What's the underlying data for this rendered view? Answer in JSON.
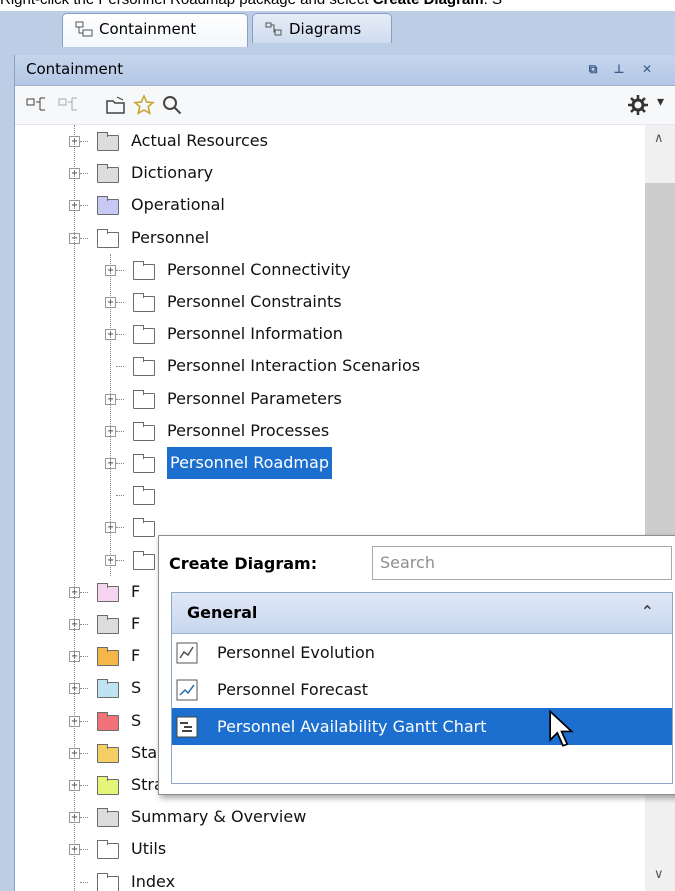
{
  "caption": {
    "pre": "Right-click the Personnel Roadmap package and select ",
    "bold": "Create Diagram",
    "post": ". S"
  },
  "tabs": [
    {
      "label": "Containment",
      "active": true,
      "icon": "containment-icon"
    },
    {
      "label": "Diagrams",
      "active": false,
      "icon": "diagrams-icon"
    }
  ],
  "panel": {
    "title": "Containment",
    "title_buttons": [
      "float-icon",
      "pin-icon",
      "close-icon"
    ]
  },
  "toolbar": {
    "left_tools": [
      "collapse-icon",
      "expand-icon",
      "open-folder-icon",
      "star-icon",
      "search-icon"
    ],
    "right_tools": [
      "gear-icon",
      "dropdown-arrow-icon"
    ]
  },
  "tree": [
    {
      "label": "Actual Resources",
      "level": 0,
      "exp": "plus",
      "color": "#dcdcdc"
    },
    {
      "label": "Dictionary",
      "level": 0,
      "exp": "plus",
      "color": "#dcdcdc"
    },
    {
      "label": "Operational",
      "level": 0,
      "exp": "plus",
      "color": "#c8c8f5"
    },
    {
      "label": "Personnel",
      "level": 0,
      "exp": "minus",
      "color": "#ffffff"
    },
    {
      "label": "Personnel Connectivity",
      "level": 1,
      "exp": "plus",
      "color": "#ffffff"
    },
    {
      "label": "Personnel Constraints",
      "level": 1,
      "exp": "plus",
      "color": "#ffffff"
    },
    {
      "label": "Personnel Information",
      "level": 1,
      "exp": "plus",
      "color": "#ffffff"
    },
    {
      "label": "Personnel Interaction Scenarios",
      "level": 1,
      "exp": "none",
      "color": "#ffffff"
    },
    {
      "label": "Personnel Parameters",
      "level": 1,
      "exp": "plus",
      "color": "#ffffff"
    },
    {
      "label": "Personnel Processes",
      "level": 1,
      "exp": "plus",
      "color": "#ffffff"
    },
    {
      "label": "Personnel Roadmap",
      "level": 1,
      "exp": "plus",
      "color": "#ffffff",
      "selected": true
    },
    {
      "label": "",
      "level": 1,
      "exp": "none",
      "color": "#ffffff"
    },
    {
      "label": "",
      "level": 1,
      "exp": "plus",
      "color": "#ffffff"
    },
    {
      "label": "",
      "level": 1,
      "exp": "plus",
      "color": "#ffffff"
    },
    {
      "label": "F",
      "level": 0,
      "exp": "plus",
      "color": "#f6d4f0"
    },
    {
      "label": "F",
      "level": 0,
      "exp": "plus",
      "color": "#dcdcdc"
    },
    {
      "label": "F",
      "level": 0,
      "exp": "plus",
      "color": "#f5b74a"
    },
    {
      "label": "S",
      "level": 0,
      "exp": "plus",
      "color": "#bfe3f2"
    },
    {
      "label": "S",
      "level": 0,
      "exp": "plus",
      "color": "#f2727a"
    },
    {
      "label": "Standards",
      "level": 0,
      "exp": "plus",
      "color": "#f3cf66"
    },
    {
      "label": "Strategy",
      "level": 0,
      "exp": "plus",
      "color": "#e4f57a"
    },
    {
      "label": "Summary & Overview",
      "level": 0,
      "exp": "plus",
      "color": "#dcdcdc"
    },
    {
      "label": "Utils",
      "level": 0,
      "exp": "plus",
      "color": "#ffffff",
      "utils": true
    },
    {
      "label": "Index",
      "level": 0,
      "exp": "none",
      "color": "#ffffff"
    }
  ],
  "popup": {
    "label": "Create Diagram:",
    "search_placeholder": "Search",
    "group": "General",
    "group_chevron": "⌃",
    "items": [
      {
        "label": "Personnel Evolution",
        "icon": "evolution-diagram-icon",
        "active": false
      },
      {
        "label": "Personnel Forecast",
        "icon": "forecast-diagram-icon",
        "active": false
      },
      {
        "label": "Personnel Availability Gantt Chart",
        "icon": "gantt-chart-icon",
        "active": true
      }
    ]
  }
}
